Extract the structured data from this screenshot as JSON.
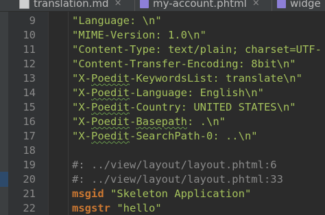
{
  "tabs": [
    {
      "label": "translation.md",
      "icon": "markdown-file-icon"
    },
    {
      "label": "my-account.phtml",
      "icon": "php-file-icon"
    },
    {
      "label": "widge",
      "icon": "php-file-icon"
    }
  ],
  "line_numbers": [
    "9",
    "10",
    "11",
    "12",
    "13",
    "14",
    "15",
    "16",
    "17",
    "18",
    "19",
    "20",
    "21",
    "22"
  ],
  "lines": {
    "l9": {
      "text": "\"Language: \\n\""
    },
    "l10": {
      "text": "\"MIME-Version: 1.0\\n\""
    },
    "l11": {
      "text": "\"Content-Type: text/plain; charset=UTF-"
    },
    "l12": {
      "text": "\"Content-Transfer-Encoding: 8bit\\n\""
    },
    "l13": {
      "prefix": "\"X-",
      "squiggle": "Poedit",
      "suffix": "-KeywordsList: translate\\n\""
    },
    "l14": {
      "prefix": "\"X-",
      "squiggle": "Poedit",
      "suffix": "-Language: English\\n\""
    },
    "l15": {
      "prefix": "\"X-",
      "squiggle": "Poedit",
      "suffix": "-Country: UNITED STATES\\n\""
    },
    "l16": {
      "prefix": "\"X-",
      "squiggle": "Poedit",
      "mid": "-",
      "squiggle2": "Basepath",
      "suffix": ": .\\n\""
    },
    "l17": {
      "prefix": "\"X-",
      "squiggle": "Poedit",
      "suffix": "-SearchPath-0: ..\\n\""
    },
    "l18": {
      "text": ""
    },
    "l19": {
      "text": "#: ../view/layout/layout.phtml:6"
    },
    "l20": {
      "text": "#: ../view/layout/layout.phtml:33"
    },
    "l21": {
      "keyword": "msgid",
      "value": " \"Skeleton Application\""
    },
    "l22": {
      "keyword": "msgstr",
      "value": " \"hello\""
    }
  },
  "colors": {
    "background": "#2b2b2b",
    "string": "#a5c25c",
    "comment": "#8a8a8a",
    "keyword": "#cc7832",
    "line_number": "#8a8a8a"
  }
}
